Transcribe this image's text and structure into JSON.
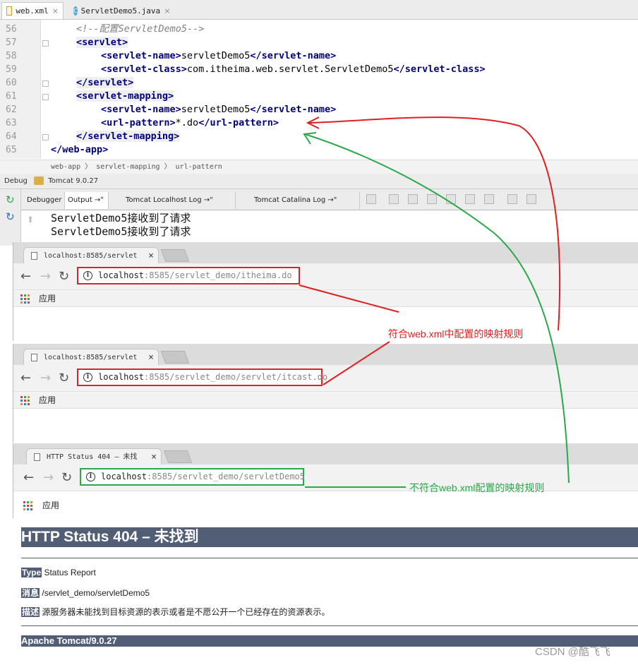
{
  "ide": {
    "tabs": [
      {
        "label": "web.xml",
        "close": "×",
        "icon": "xml-file-icon"
      },
      {
        "label": "ServletDemo5.java",
        "close": "×",
        "icon": "java-class-icon"
      }
    ],
    "line_numbers": [
      "56",
      "57",
      "58",
      "59",
      "60",
      "61",
      "62",
      "63",
      "64",
      "65"
    ],
    "code": {
      "l56": "<!--配置ServletDemo5-->",
      "l57_tag": "<servlet>",
      "l58_open": "<servlet-name>",
      "l58_text": "servletDemo5",
      "l58_close": "</servlet-name>",
      "l59_open": "<servlet-class>",
      "l59_text": "com.itheima.web.servlet.ServletDemo5",
      "l59_close": "</servlet-class>",
      "l60_tag": "</servlet>",
      "l61_tag": "<servlet-mapping>",
      "l62_open": "<servlet-name>",
      "l62_text": "servletDemo5",
      "l62_close": "</servlet-name>",
      "l63_open": "<url-pattern>",
      "l63_text": "*.do",
      "l63_close": "</url-pattern>",
      "l64_tag": "</servlet-mapping>",
      "l65_tag": "</web-app>"
    },
    "breadcrumb": "web-app  〉  servlet-mapping  〉  url-pattern",
    "debug_label": "Debug",
    "debug_config": "Tomcat 9.0.27",
    "debug_tabs": [
      "Debugger",
      "Output →\"",
      "Tomcat Localhost Log →\"",
      "Tomcat Catalina Log →\""
    ],
    "console_lines": [
      "ServletDemo5接收到了请求",
      "ServletDemo5接收到了请求"
    ]
  },
  "browsers": [
    {
      "tab_title": "localhost:8585/servlet",
      "host": "localhost",
      "path": ":8585/servlet_demo/itheima.do",
      "apps_label": "应用",
      "close": "×"
    },
    {
      "tab_title": "localhost:8585/servlet",
      "host": "localhost",
      "path": ":8585/servlet_demo/servlet/itcast.do",
      "apps_label": "应用",
      "close": "×"
    },
    {
      "tab_title": "HTTP Status 404 – 未找",
      "host": "localhost",
      "path": ":8585/servlet_demo/servletDemo5",
      "apps_label": "应用",
      "close": "×"
    }
  ],
  "error_page": {
    "heading": "HTTP Status 404 – 未找到",
    "type_label": "Type",
    "type_value": "Status Report",
    "message_label": "消息",
    "message_value": "/servlet_demo/servletDemo5",
    "desc_label": "描述",
    "desc_value": "源服务器未能找到目标资源的表示或者是不愿公开一个已经存在的资源表示。",
    "footer": "Apache Tomcat/9.0.27"
  },
  "annotations": {
    "match": "符合web.xml中配置的映射规则",
    "no_match": "不符合web.xml配置的映射规则",
    "match_color": "#e02020",
    "no_match_color": "#2aa84a"
  },
  "watermark": "CSDN @酷飞飞"
}
